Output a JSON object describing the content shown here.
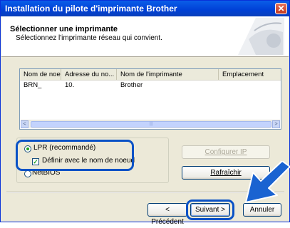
{
  "window": {
    "title": "Installation du pilote d'imprimante Brother",
    "close_label": "✕"
  },
  "header": {
    "title": "Sélectionner une imprimante",
    "subtitle": "Sélectionnez l'imprimante réseau qui convient."
  },
  "printer_list": {
    "columns": [
      "Nom de noeud",
      "Adresse du no...",
      "Nom de l'imprimante",
      "Emplacement"
    ],
    "rows": [
      {
        "node": "BRN_",
        "address": "10.",
        "printer": "Brother",
        "location": ""
      }
    ],
    "scroll_left": "<",
    "scroll_right": ">",
    "thumb_grip": "|||"
  },
  "protocol": {
    "lpr_label": "LPR (recommandé)",
    "lpr_selected": true,
    "define_by_node_label": "Définir avec le nom de noeud",
    "define_by_node_checked": true,
    "netbios_label": "NetBIOS",
    "check_mark": "✓"
  },
  "buttons": {
    "configure_ip": "Configurer IP",
    "refresh": "Rafraîchir",
    "back": "< Précédent",
    "next": "Suivant >",
    "cancel": "Annuler"
  },
  "colors": {
    "highlight": "#0a52c6",
    "title_bar": "#0040d6",
    "arrow": "#1a63d1"
  }
}
